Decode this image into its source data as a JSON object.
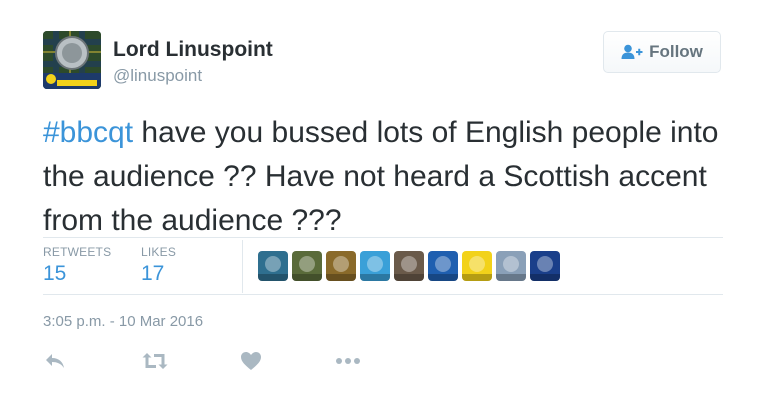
{
  "user": {
    "display_name": "Lord Linuspoint",
    "handle": "@linuspoint",
    "avatar_caption": "Working for Scotland"
  },
  "follow": {
    "label": "Follow"
  },
  "tweet": {
    "hashtag": "#bbcqt",
    "text_rest": " have you bussed lots of English people into the audience ?? Have not heard a Scottish accent from the audience ???"
  },
  "stats": {
    "retweets_label": "RETWEETS",
    "retweets_value": "15",
    "likes_label": "LIKES",
    "likes_value": "17"
  },
  "likers": [
    {
      "icon": "avatar-ornament",
      "color": "#2f6f8f"
    },
    {
      "icon": "avatar-photo",
      "color": "#5a6b3a"
    },
    {
      "icon": "avatar-badge",
      "color": "#8a6a2a"
    },
    {
      "icon": "avatar-kate-forbes",
      "color": "#3aa0d8"
    },
    {
      "icon": "avatar-building",
      "color": "#6a5a4a"
    },
    {
      "icon": "avatar-saltire",
      "color": "#1f5fb0"
    },
    {
      "icon": "avatar-snp",
      "color": "#f2d21a"
    },
    {
      "icon": "avatar-snp-flag",
      "color": "#8aa0b8"
    },
    {
      "icon": "avatar-n-snp",
      "color": "#1a3f8a"
    }
  ],
  "timestamp": "3:05 p.m. - 10 Mar 2016",
  "colors": {
    "link": "#3b94d9",
    "muted": "#8899a6",
    "text": "#292f33",
    "divider": "#e1e8ed",
    "icon": "#aab8c2"
  }
}
